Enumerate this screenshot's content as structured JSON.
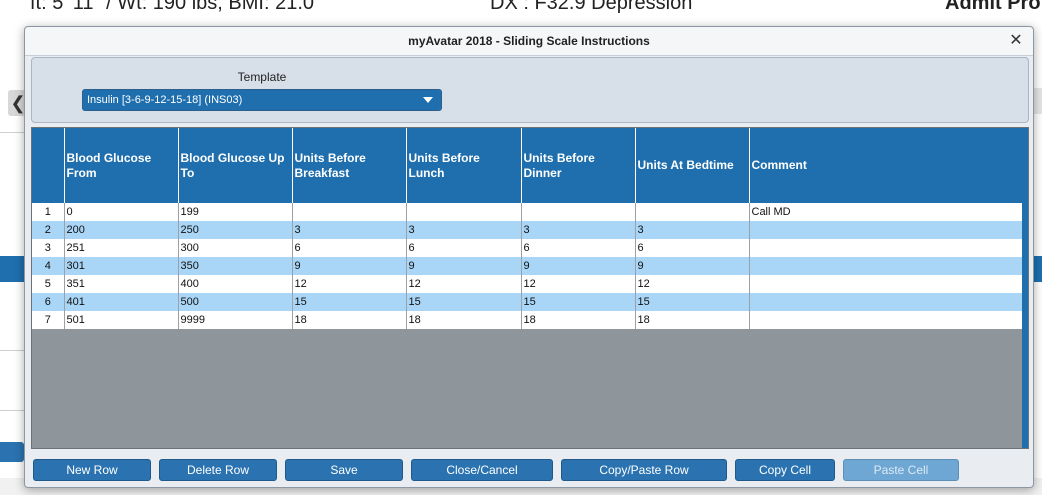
{
  "background": {
    "header_left": "ft: 5' 11\" / Wt: 190 lbs, BMI: 21.0",
    "header_mid": "DX : F32.9 Depression",
    "header_right": "Admit Pro"
  },
  "dialog": {
    "title": "myAvatar 2018 - Sliding Scale Instructions",
    "template": {
      "label": "Template",
      "selected": "Insulin [3-6-9-12-15-18] (INS03)"
    },
    "table": {
      "headers": [
        "",
        "Blood Glucose From",
        "Blood Glucose Up To",
        "Units Before Breakfast",
        "Units Before Lunch",
        "Units Before Dinner",
        "Units At Bedtime",
        "Comment"
      ],
      "rows": [
        {
          "n": "1",
          "from": "0",
          "to": "199",
          "breakfast": "",
          "lunch": "",
          "dinner": "",
          "bedtime": "",
          "comment": "Call MD"
        },
        {
          "n": "2",
          "from": "200",
          "to": "250",
          "breakfast": "3",
          "lunch": "3",
          "dinner": "3",
          "bedtime": "3",
          "comment": ""
        },
        {
          "n": "3",
          "from": "251",
          "to": "300",
          "breakfast": "6",
          "lunch": "6",
          "dinner": "6",
          "bedtime": "6",
          "comment": ""
        },
        {
          "n": "4",
          "from": "301",
          "to": "350",
          "breakfast": "9",
          "lunch": "9",
          "dinner": "9",
          "bedtime": "9",
          "comment": ""
        },
        {
          "n": "5",
          "from": "351",
          "to": "400",
          "breakfast": "12",
          "lunch": "12",
          "dinner": "12",
          "bedtime": "12",
          "comment": ""
        },
        {
          "n": "6",
          "from": "401",
          "to": "500",
          "breakfast": "15",
          "lunch": "15",
          "dinner": "15",
          "bedtime": "15",
          "comment": ""
        },
        {
          "n": "7",
          "from": "501",
          "to": "9999",
          "breakfast": "18",
          "lunch": "18",
          "dinner": "18",
          "bedtime": "18",
          "comment": ""
        }
      ]
    },
    "buttons": {
      "new_row": "New Row",
      "delete_row": "Delete Row",
      "save": "Save",
      "close_cancel": "Close/Cancel",
      "copy_paste_row": "Copy/Paste Row",
      "copy_cell": "Copy Cell",
      "paste_cell": "Paste Cell"
    }
  },
  "colors": {
    "header_blue": "#1f6fae",
    "row_alt": "#a9d6f7",
    "grid_bg": "#8f969b"
  }
}
